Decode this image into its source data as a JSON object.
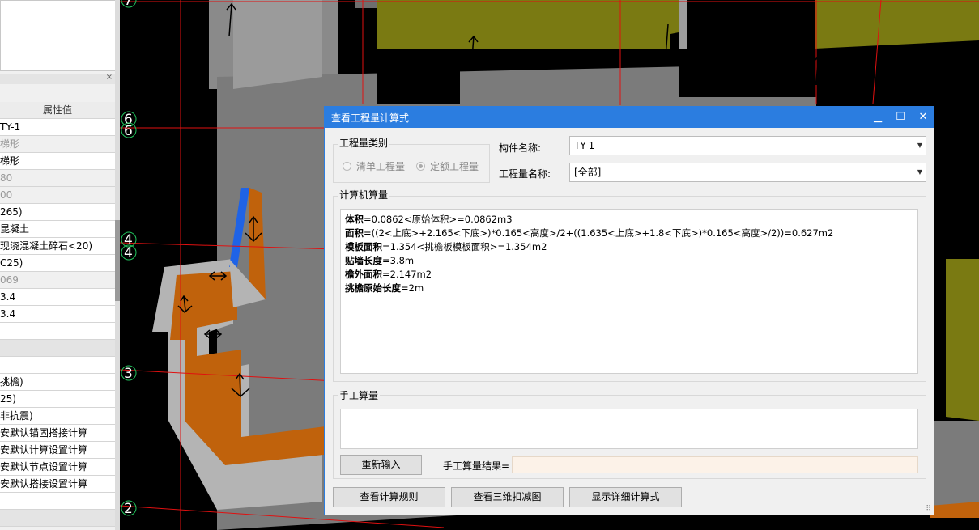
{
  "left_panel": {
    "title_close": "×",
    "header": "属性值",
    "rows": [
      {
        "text": "TY-1",
        "style": "normal"
      },
      {
        "text": "梯形",
        "style": "grey"
      },
      {
        "text": "梯形",
        "style": "normal"
      },
      {
        "text": "80",
        "style": "grey"
      },
      {
        "text": "00",
        "style": "grey"
      },
      {
        "text": "265)",
        "style": "normal"
      },
      {
        "text": "昆凝土",
        "style": "normal"
      },
      {
        "text": "现浇混凝土碎石<20)",
        "style": "normal"
      },
      {
        "text": "C25)",
        "style": "normal"
      },
      {
        "text": "069",
        "style": "grey"
      },
      {
        "text": "3.4",
        "style": "normal"
      },
      {
        "text": "3.4",
        "style": "normal"
      },
      {
        "text": "",
        "style": "normal"
      },
      {
        "text": "",
        "style": "sec"
      },
      {
        "text": "",
        "style": "normal"
      },
      {
        "text": "挑檐)",
        "style": "normal"
      },
      {
        "text": "25)",
        "style": "normal"
      },
      {
        "text": "非抗震)",
        "style": "normal"
      },
      {
        "text": "安默认锚固搭接计算",
        "style": "normal"
      },
      {
        "text": "安默认计算设置计算",
        "style": "normal"
      },
      {
        "text": "安默认节点设置计算",
        "style": "normal"
      },
      {
        "text": "安默认搭接设置计算",
        "style": "normal"
      },
      {
        "text": "",
        "style": "normal"
      },
      {
        "text": "",
        "style": "sec"
      }
    ]
  },
  "view": {
    "axis_labels": [
      {
        "label": "7"
      },
      {
        "label": "6"
      },
      {
        "label": "6"
      },
      {
        "label": "4"
      },
      {
        "label": "4"
      },
      {
        "label": "3"
      },
      {
        "label": "2"
      }
    ]
  },
  "dialog": {
    "title": "查看工程量计算式",
    "minimize": "▁",
    "maximize": "☐",
    "close": "✕",
    "category_group": "工程量类别",
    "radio_list": "清单工程量",
    "radio_quota": "定额工程量",
    "component_label": "构件名称:",
    "component_value": "TY-1",
    "quantity_label": "工程量名称:",
    "quantity_value": "[全部]",
    "computer_group": "计算机算量",
    "calc_lines": [
      {
        "name": "体积",
        "expr": "=0.0862<原始体积>=0.0862m3"
      },
      {
        "name": "面积",
        "expr": "=((2<上底>+2.165<下底>)*0.165<高度>/2+((1.635<上底>+1.8<下底>)*0.165<高度>/2))=0.627m2"
      },
      {
        "name": "模板面积",
        "expr": "=1.354<挑檐板模板面积>=1.354m2"
      },
      {
        "name": "贴墙长度",
        "expr": "=3.8m"
      },
      {
        "name": "檐外面积",
        "expr": "=2.147m2"
      },
      {
        "name": "挑檐原始长度",
        "expr": "=2m"
      }
    ],
    "manual_group": "手工算量",
    "reenter_button": "重新输入",
    "manual_result_label": "手工算量结果=",
    "btn_rules": "查看计算规则",
    "btn_3d": "查看三维扣减图",
    "btn_detail": "显示详细计算式",
    "resize_grip": "⠿"
  }
}
